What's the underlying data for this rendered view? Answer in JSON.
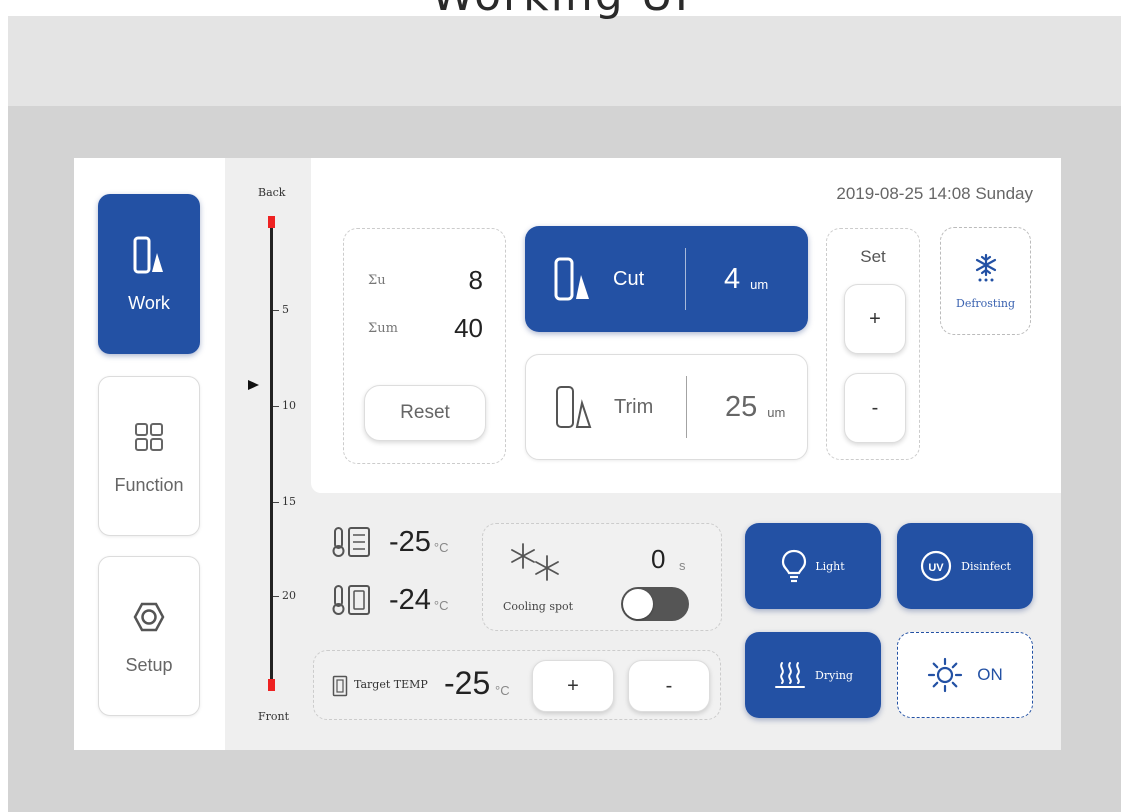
{
  "page": {
    "title": "Working UI"
  },
  "nav": {
    "items": [
      {
        "label": "Work",
        "icon": "blade-icon",
        "active": true
      },
      {
        "label": "Function",
        "icon": "grid-icon",
        "active": false
      },
      {
        "label": "Setup",
        "icon": "hexagon-icon",
        "active": false
      }
    ]
  },
  "scale": {
    "top_label": "Back",
    "bottom_label": "Front",
    "ticks": [
      "5",
      "10",
      "15",
      "20"
    ],
    "pointer_value": 10,
    "marker_color": "#e22222"
  },
  "header": {
    "datetime": "2019-08-25  14:08  Sunday"
  },
  "counter": {
    "sum_u_label": "Σu",
    "sum_u_value": "8",
    "sum_um_label": "Σum",
    "sum_um_value": "40",
    "reset_label": "Reset"
  },
  "modes": {
    "cut": {
      "label": "Cut",
      "value": "4",
      "unit": "um",
      "active": true
    },
    "trim": {
      "label": "Trim",
      "value": "25",
      "unit": "um",
      "active": false
    }
  },
  "set": {
    "label": "Set",
    "plus": "+",
    "minus": "-"
  },
  "defrost": {
    "label": "Defrosting",
    "icon": "snowflake-icon"
  },
  "temps": {
    "t1": {
      "value": "-25",
      "unit": "°C",
      "icon": "thermometer-icon"
    },
    "t2": {
      "value": "-24",
      "unit": "°C",
      "icon": "thermometer-icon"
    }
  },
  "cooling": {
    "label": "Cooling spot",
    "value": "0",
    "unit": "s",
    "toggle_on": false,
    "icon": "snowflakes-icon"
  },
  "target": {
    "label": "Target TEMP",
    "value": "-25",
    "unit": "°C",
    "plus": "+",
    "minus": "-"
  },
  "actions": {
    "light": {
      "label": "Light",
      "icon": "bulb-icon"
    },
    "disinfect": {
      "label": "Disinfect",
      "icon": "uv-icon",
      "badge": "UV"
    },
    "drying": {
      "label": "Drying",
      "icon": "heat-icon"
    },
    "power": {
      "label": "ON",
      "icon": "sun-icon"
    }
  },
  "colors": {
    "accent": "#2351a4",
    "page_band": "#e4e4e4",
    "outer_panel": "#d3d3d3",
    "screen_bg": "#efefef"
  }
}
